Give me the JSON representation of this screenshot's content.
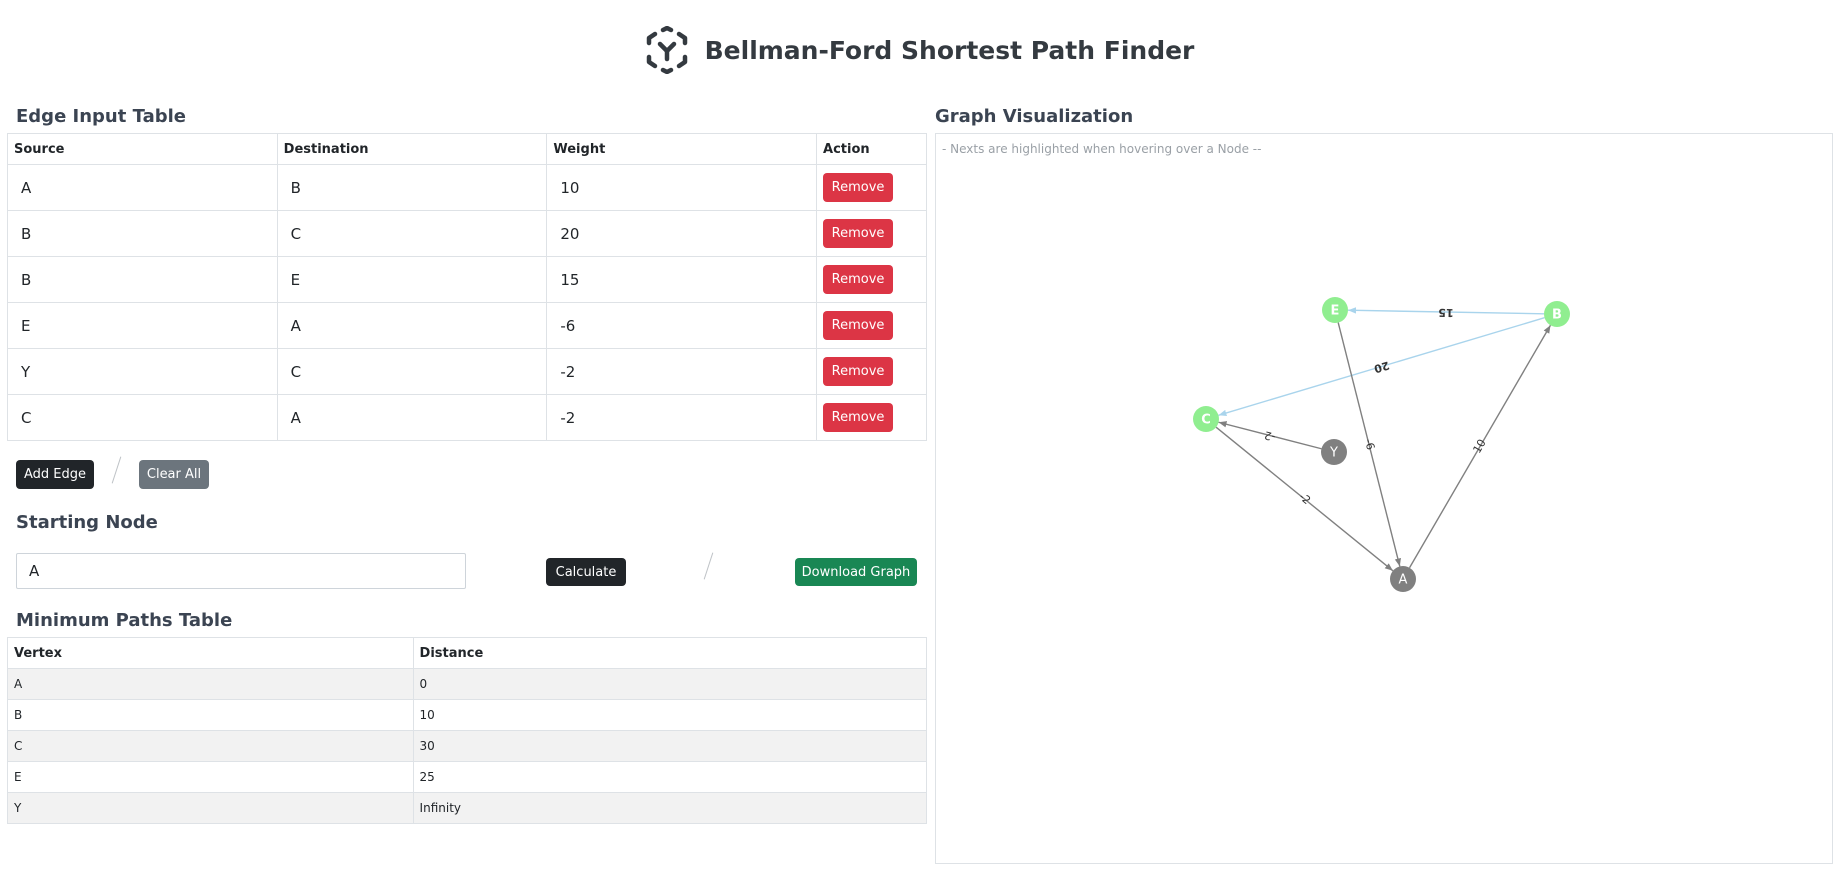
{
  "header": {
    "title": "Bellman-Ford Shortest Path Finder",
    "logo_icon": "hexagon-y-logo-icon"
  },
  "edge_section": {
    "title": "Edge Input Table",
    "columns": [
      "Source",
      "Destination",
      "Weight",
      "Action"
    ],
    "rows": [
      {
        "source": "A",
        "destination": "B",
        "weight": "10",
        "action": "Remove"
      },
      {
        "source": "B",
        "destination": "C",
        "weight": "20",
        "action": "Remove"
      },
      {
        "source": "B",
        "destination": "E",
        "weight": "15",
        "action": "Remove"
      },
      {
        "source": "E",
        "destination": "A",
        "weight": "-6",
        "action": "Remove"
      },
      {
        "source": "Y",
        "destination": "C",
        "weight": "-2",
        "action": "Remove"
      },
      {
        "source": "C",
        "destination": "A",
        "weight": "-2",
        "action": "Remove"
      }
    ],
    "add_edge_label": "Add Edge",
    "clear_all_label": "Clear All"
  },
  "start_section": {
    "title": "Starting Node",
    "value": "A",
    "calculate_label": "Calculate",
    "download_label": "Download Graph"
  },
  "paths_section": {
    "title": "Minimum Paths Table",
    "columns": [
      "Vertex",
      "Distance"
    ],
    "rows": [
      {
        "vertex": "A",
        "distance": "0"
      },
      {
        "vertex": "B",
        "distance": "10"
      },
      {
        "vertex": "C",
        "distance": "30"
      },
      {
        "vertex": "E",
        "distance": "25"
      },
      {
        "vertex": "Y",
        "distance": "Infinity"
      }
    ]
  },
  "graph": {
    "title": "Graph Visualization",
    "hint": "- Nexts are highlighted when hovering over a Node --",
    "colors": {
      "highlight_node": "#90ee90",
      "default_node": "#808080",
      "highlight_edge": "#a9d4ec",
      "default_edge": "#808080"
    },
    "nodes": [
      {
        "id": "E",
        "highlighted": true
      },
      {
        "id": "B",
        "highlighted": true
      },
      {
        "id": "C",
        "highlighted": true
      },
      {
        "id": "Y",
        "highlighted": false
      },
      {
        "id": "A",
        "highlighted": false
      }
    ],
    "edges": [
      {
        "from": "A",
        "to": "B",
        "label": "10",
        "highlighted": false
      },
      {
        "from": "B",
        "to": "C",
        "label": "20",
        "highlighted": true
      },
      {
        "from": "B",
        "to": "E",
        "label": "15",
        "highlighted": true
      },
      {
        "from": "E",
        "to": "A",
        "label": "-6",
        "highlighted": false
      },
      {
        "from": "Y",
        "to": "C",
        "label": "-2",
        "highlighted": false
      },
      {
        "from": "C",
        "to": "A",
        "label": "-2",
        "highlighted": false
      }
    ]
  }
}
